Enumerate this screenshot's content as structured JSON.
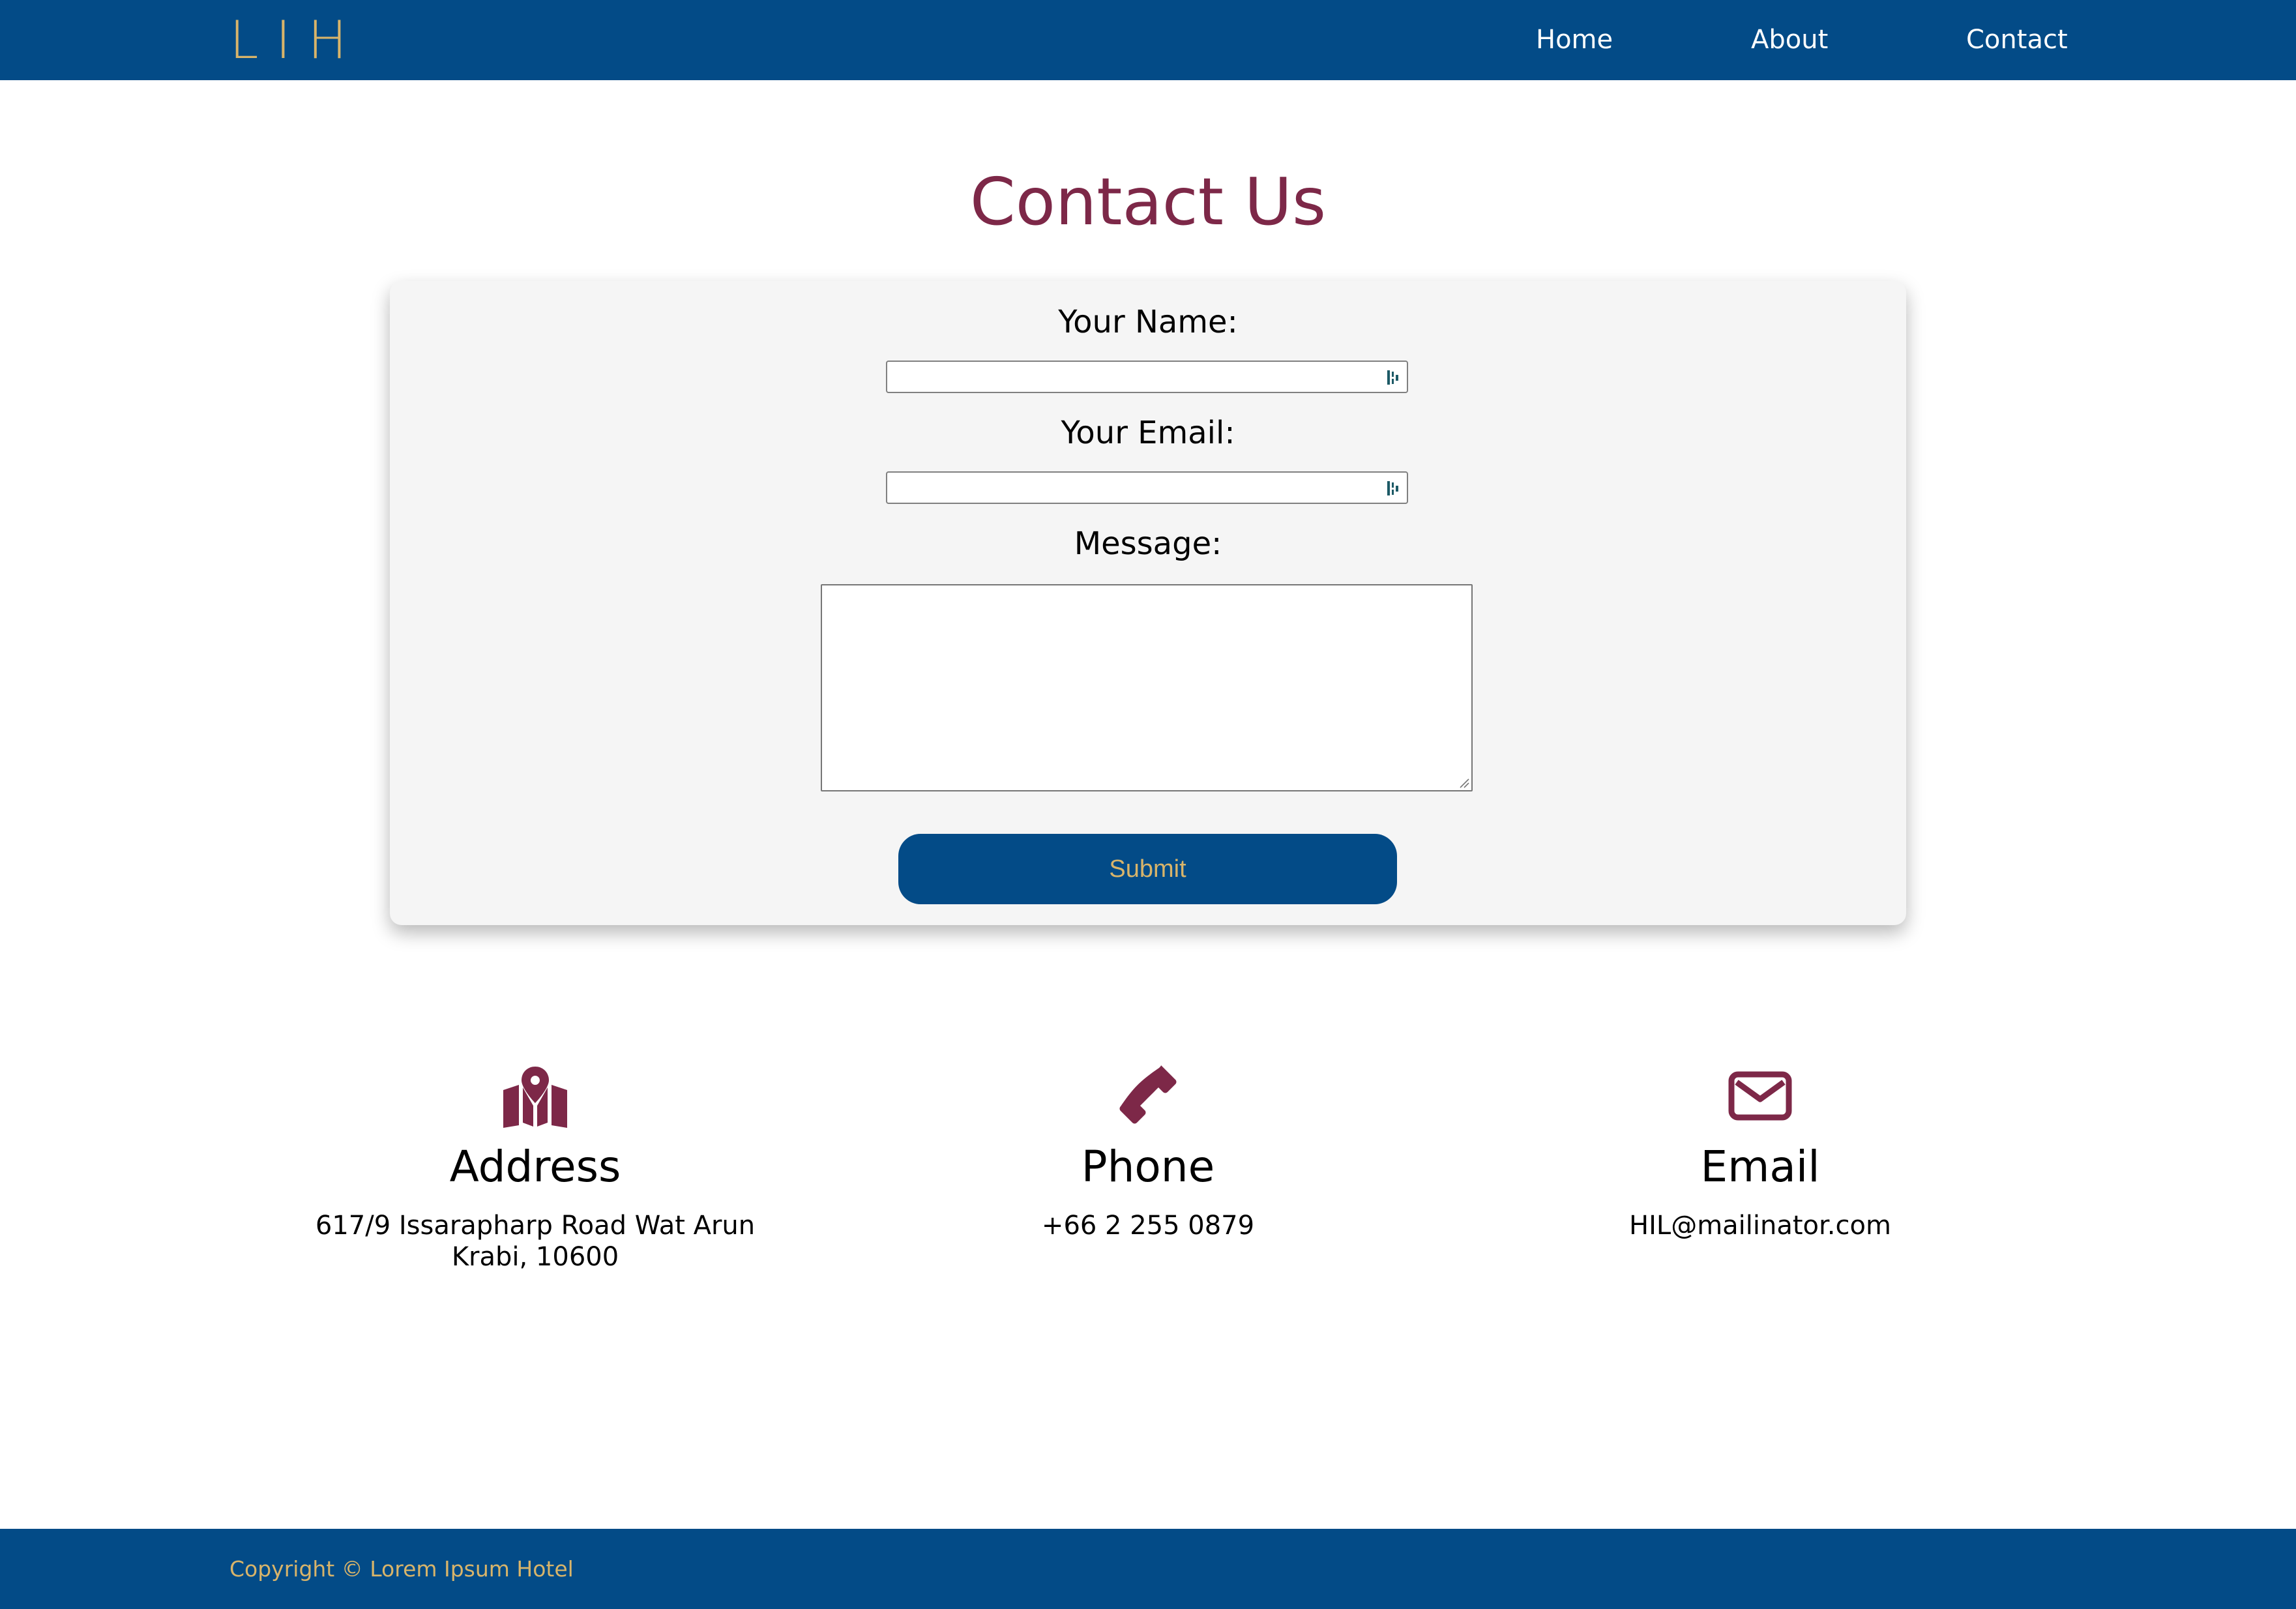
{
  "header": {
    "logo": "LIH",
    "nav": {
      "home": "Home",
      "about": "About",
      "contact": "Contact"
    }
  },
  "page": {
    "title": "Contact Us"
  },
  "form": {
    "name_label": "Your Name:",
    "name_value": "",
    "email_label": "Your Email:",
    "email_value": "",
    "message_label": "Message:",
    "message_value": "",
    "submit_label": "Submit",
    "field_icon": "password-manager-icon"
  },
  "info": {
    "address": {
      "icon": "map-marker-icon",
      "heading": "Address",
      "line1": "617/9 Issarapharp Road Wat Arun",
      "line2": "Krabi, 10600"
    },
    "phone": {
      "icon": "phone-icon",
      "heading": "Phone",
      "text": "+66 2 255 0879"
    },
    "email": {
      "icon": "envelope-icon",
      "heading": "Email",
      "text": "HIL@mailinator.com"
    }
  },
  "footer": {
    "copyright": "Copyright © Lorem Ipsum Hotel"
  },
  "colors": {
    "brand_blue": "#034b87",
    "gold": "#d8b46a",
    "maroon": "#7d2848",
    "card_bg": "#f5f5f5"
  }
}
